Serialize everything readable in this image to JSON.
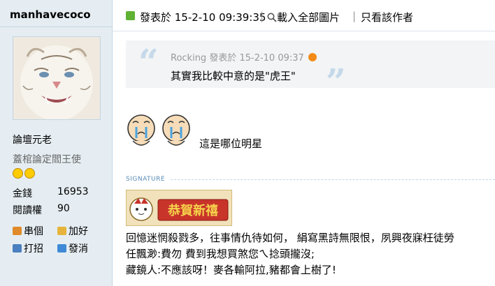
{
  "user": {
    "username": "manhavecoco",
    "rank": "論壇元老",
    "title": "蓋棺論定閻王使",
    "stats": [
      {
        "label": "金錢",
        "value": "16953"
      },
      {
        "label": "閱讀權",
        "value": "90"
      }
    ],
    "links": [
      {
        "label": "串個",
        "icon": "home-icon"
      },
      {
        "label": "加好",
        "icon": "handshake-icon"
      },
      {
        "label": "打招",
        "icon": "wave-icon"
      },
      {
        "label": "發消",
        "icon": "mail-icon"
      }
    ]
  },
  "post": {
    "time": "發表於  15-2-10 09:39:35",
    "load_images": "載入全部圖片",
    "author_only": "只看該作者",
    "quote": {
      "author": "Rocking",
      "meta_time": "發表於  15-2-10 09:37",
      "text": "其實我比較中意的是\"虎王\""
    },
    "reply_text": "這是哪位明星"
  },
  "signature": {
    "label": "SIGNATURE",
    "banner_text": "恭賀新禧",
    "lines": [
      "回憶迷惘殺戮多，往事情仇待如何，  絹寫黑詩無限恨，夙興夜寐枉徒勞",
      "任飄渺:費勿 費到我想買煞您ㄟ捻頭攏沒;",
      "藏鏡人:不應該呀！麥各輸阿拉,豬都會上樹了!"
    ]
  },
  "colors": {
    "sidebar_bg": "#e5edf2",
    "online_green": "#5fb233",
    "quote_bg": "#f2f4f6",
    "accent_blue": "#5a8cb8"
  }
}
